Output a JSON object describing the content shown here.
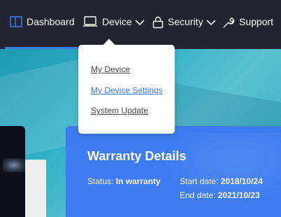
{
  "nav": {
    "items": [
      {
        "label": "Dashboard",
        "icon": "dashboard-icon"
      },
      {
        "label": "Device",
        "icon": "laptop-icon"
      },
      {
        "label": "Security",
        "icon": "lock-icon"
      },
      {
        "label": "Support",
        "icon": "wrench-icon"
      }
    ],
    "active_index": 0,
    "accent_color": "#3b78e7",
    "background_color": "#23242f"
  },
  "device_menu": {
    "items": [
      {
        "label": "My Device"
      },
      {
        "label": "My Device Settings"
      },
      {
        "label": "System Update"
      }
    ],
    "selected_index": 1
  },
  "warranty": {
    "title": "Warranty Details",
    "status_label": "Status:",
    "status_value": "In warranty",
    "start_label": "Start date:",
    "start_value": "2018/10/24",
    "end_label": "End date:",
    "end_value": "2021/10/23",
    "card_color": "#3d7cf0"
  }
}
